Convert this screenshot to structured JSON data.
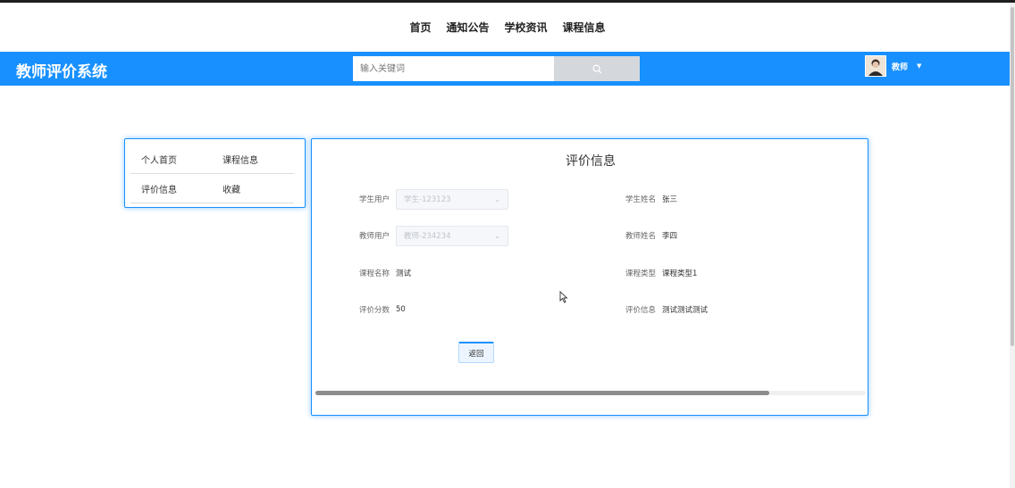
{
  "top_nav": [
    "首页",
    "通知公告",
    "学校资讯",
    "课程信息"
  ],
  "header": {
    "brand": "教师评价系统",
    "search_placeholder": "输入关键词",
    "user_name": "教师",
    "accent_color": "#1890ff"
  },
  "sidebar": {
    "items": [
      "个人首页",
      "课程信息",
      "评价信息",
      "收藏"
    ]
  },
  "panel": {
    "title": "评价信息",
    "fields": {
      "student_user_label": "学生用户",
      "student_user_value": "学生-123123",
      "student_name_label": "学生姓名",
      "student_name_value": "张三",
      "teacher_user_label": "教师用户",
      "teacher_user_value": "教师-234234",
      "teacher_name_label": "教师姓名",
      "teacher_name_value": "李四",
      "course_name_label": "课程名称",
      "course_name_value": "测试",
      "course_type_label": "课程类型",
      "course_type_value": "课程类型1",
      "score_label": "评价分数",
      "score_value": "50",
      "eval_info_label": "评价信息",
      "eval_info_value": "测试测试测试"
    },
    "back_label": "返回"
  }
}
